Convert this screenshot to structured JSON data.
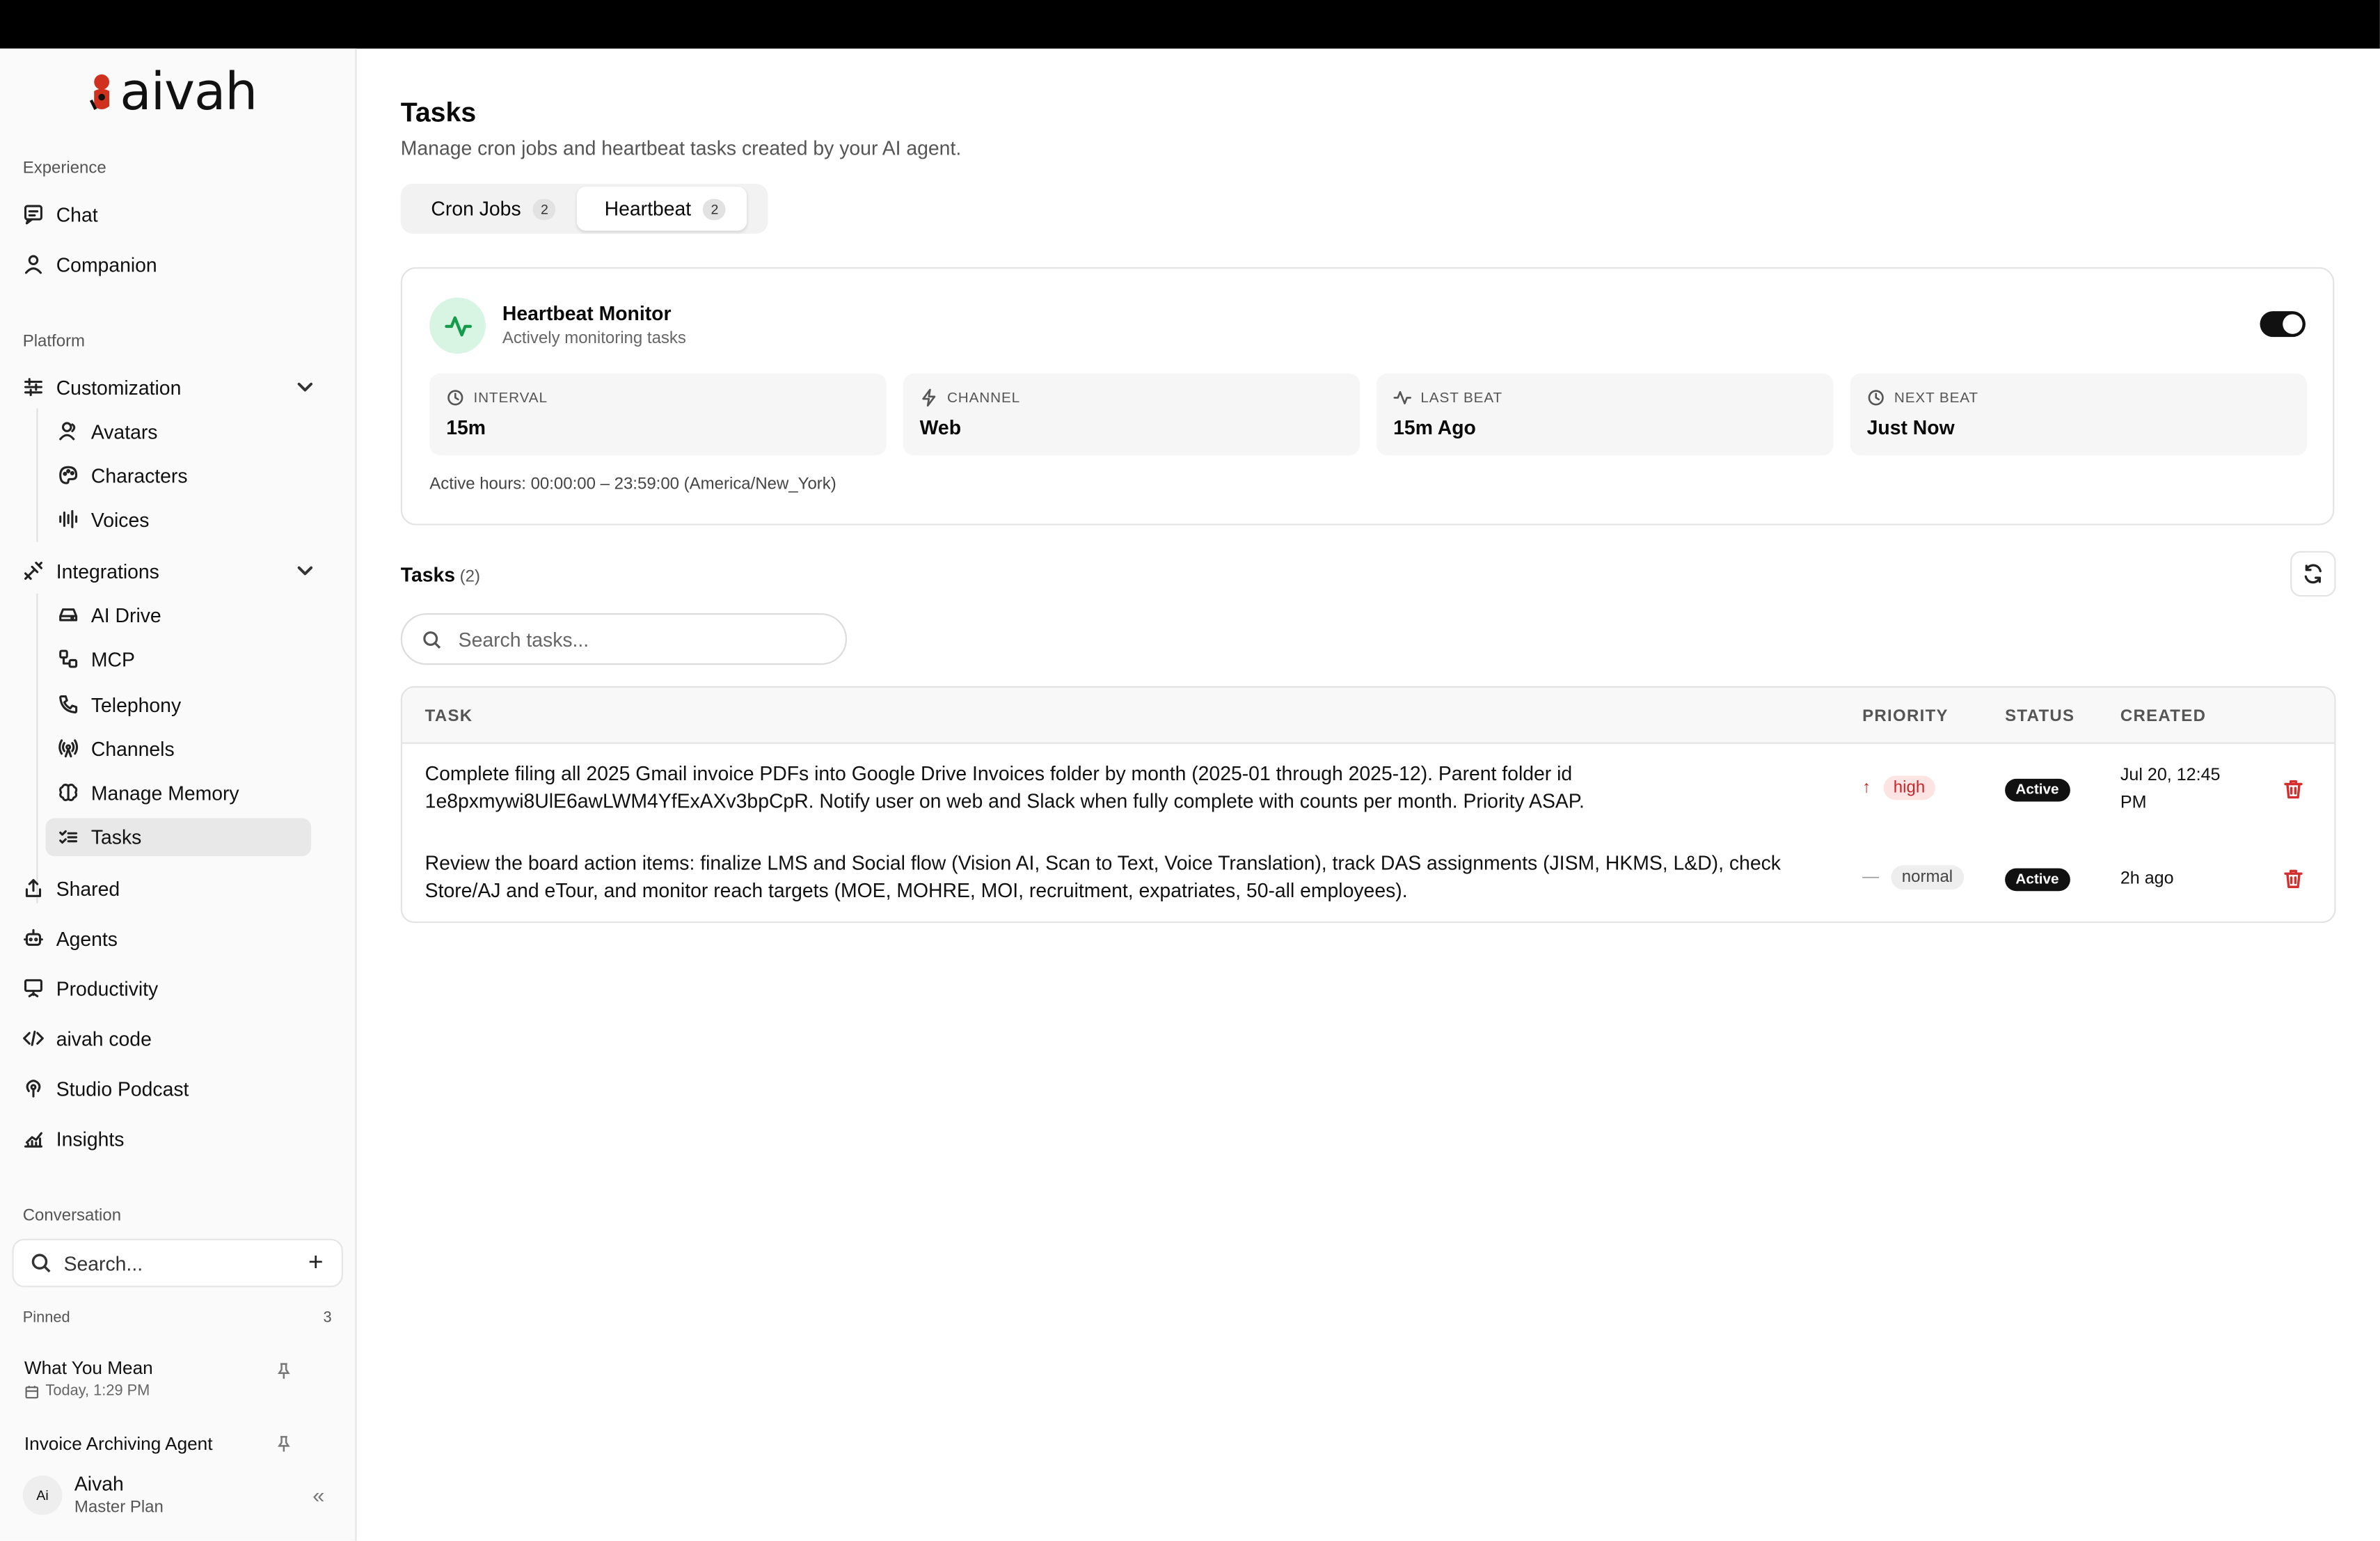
{
  "app": {
    "brand": "aivah"
  },
  "sidebar": {
    "sections": {
      "experience": "Experience",
      "platform": "Platform",
      "conversation": "Conversation"
    },
    "experience_items": [
      {
        "label": "Chat",
        "icon": "chat-icon"
      },
      {
        "label": "Companion",
        "icon": "user-icon"
      }
    ],
    "customization": {
      "label": "Customization",
      "items": [
        "Avatars",
        "Characters",
        "Voices"
      ]
    },
    "integrations": {
      "label": "Integrations",
      "items": [
        "AI Drive",
        "MCP",
        "Telephony",
        "Channels",
        "Manage Memory",
        "Tasks"
      ]
    },
    "platform_items": [
      "Shared",
      "Agents",
      "Productivity",
      "aivah code",
      "Studio Podcast",
      "Insights"
    ],
    "search_placeholder": "Search...",
    "pinned": {
      "label": "Pinned",
      "count": "3",
      "items": [
        {
          "title": "What You Mean",
          "time": "Today, 1:29 PM"
        },
        {
          "title": "Invoice Archiving Agent"
        }
      ]
    },
    "user": {
      "initials": "Ai",
      "name": "Aivah",
      "plan": "Master Plan"
    }
  },
  "main": {
    "title": "Tasks",
    "subtitle": "Manage cron jobs and heartbeat tasks created by your AI agent.",
    "tabs": [
      {
        "label": "Cron Jobs",
        "count": "2"
      },
      {
        "label": "Heartbeat",
        "count": "2",
        "active": true
      }
    ],
    "monitor": {
      "title": "Heartbeat Monitor",
      "subtitle": "Actively monitoring tasks",
      "enabled": true,
      "stats": [
        {
          "label": "INTERVAL",
          "value": "15m",
          "icon": "clock-icon"
        },
        {
          "label": "CHANNEL",
          "value": "Web",
          "icon": "lightning-icon"
        },
        {
          "label": "LAST BEAT",
          "value": "15m Ago",
          "icon": "pulse-icon"
        },
        {
          "label": "NEXT BEAT",
          "value": "Just Now",
          "icon": "clock-icon"
        }
      ],
      "active_hours": "Active hours: 00:00:00 – 23:59:00 (America/New_York)"
    },
    "tasks": {
      "heading": "Tasks",
      "count": "(2)",
      "search_placeholder": "Search tasks...",
      "columns": [
        "TASK",
        "PRIORITY",
        "STATUS",
        "CREATED"
      ],
      "rows": [
        {
          "task_line1": "Complete filing all 2025 Gmail invoice PDFs into Google Drive Invoices folder by month (2025-01 through 2025-12). Parent folder id",
          "task_line2": "1e8pxmywi8UlE6awLWM4YfExAXv3bpCpR. Notify user on web and Slack when fully complete with counts per month. Priority ASAP.",
          "priority_marker": "↑",
          "priority": "high",
          "status": "Active",
          "created_line1": "Jul 20, 12:45",
          "created_line2": "PM"
        },
        {
          "task_line1": "Review the board action items: finalize LMS and Social flow (Vision AI, Scan to Text, Voice Translation), track DAS assignments (JISM, HKMS, L&D), check",
          "task_line2": "Store/AJ and eTour, and monitor reach targets (MOE, MOHRE, MOI, recruitment, expatriates, 50-all employees).",
          "priority_marker": "—",
          "priority": "normal",
          "status": "Active",
          "created_line1": "2h ago",
          "created_line2": ""
        }
      ]
    }
  },
  "colors": {
    "accent_green": "#169b4d",
    "danger": "#d32f2f",
    "high_bg": "#fde4e4"
  }
}
